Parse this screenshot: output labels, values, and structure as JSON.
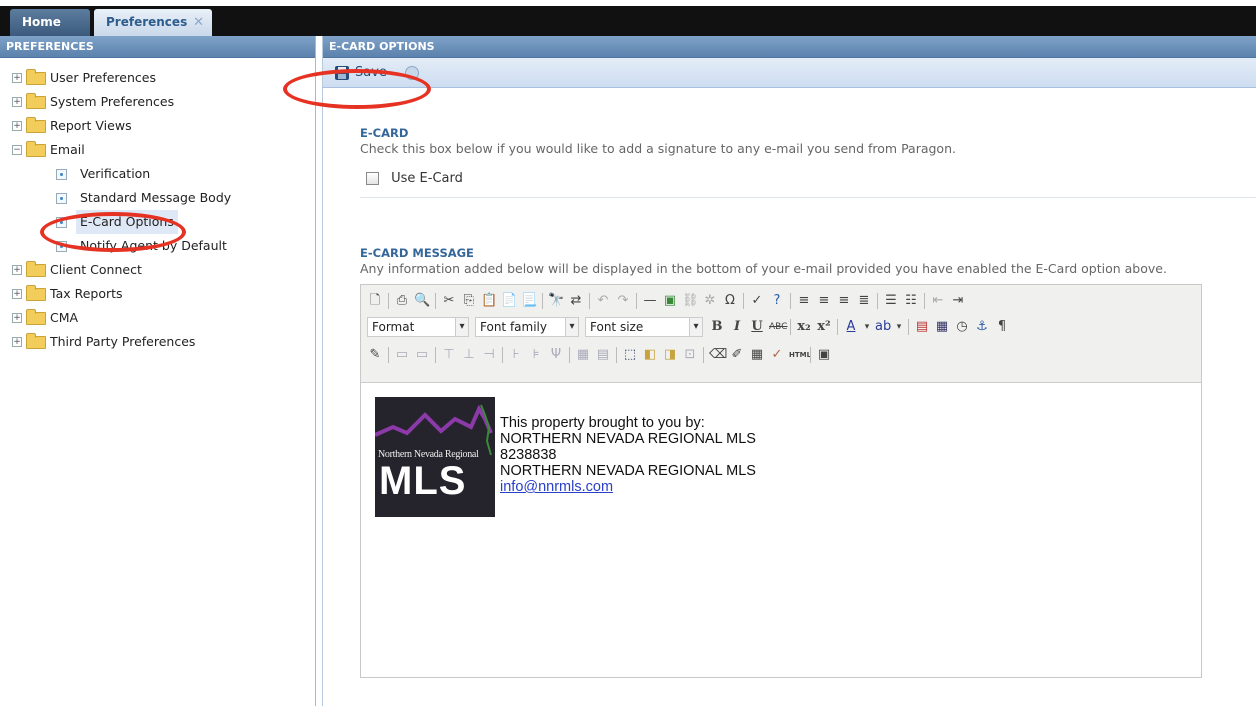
{
  "tabs": [
    {
      "label": "Home"
    },
    {
      "label": "Preferences",
      "close": "✕"
    }
  ],
  "left_panel": {
    "title": "PREFERENCES",
    "tree": [
      {
        "label": "User Preferences",
        "expander": "+"
      },
      {
        "label": "System Preferences",
        "expander": "+"
      },
      {
        "label": "Report Views",
        "expander": "+"
      },
      {
        "label": "Email",
        "expander": "−"
      },
      {
        "label": "Verification"
      },
      {
        "label": "Standard Message Body"
      },
      {
        "label": "E-Card Options",
        "selected": true
      },
      {
        "label": "Notify Agent by Default"
      },
      {
        "label": "Client Connect",
        "expander": "+"
      },
      {
        "label": "Tax Reports",
        "expander": "+"
      },
      {
        "label": "CMA",
        "expander": "+"
      },
      {
        "label": "Third Party Preferences",
        "expander": "+"
      }
    ]
  },
  "right_panel": {
    "title": "E-CARD OPTIONS",
    "toolbar": {
      "save_label": "Save"
    },
    "ecard": {
      "title": "E-CARD",
      "description": "Check this box below if you would like to add a signature to any e-mail you send from Paragon.",
      "checkbox_label": "Use E-Card"
    },
    "message": {
      "title": "E-CARD MESSAGE",
      "description": "Any information added below will be displayed in the bottom of your e-mail provided you have enabled the E-Card option above."
    },
    "editor": {
      "format_label": "Format",
      "font_family_label": "Font family",
      "font_size_label": "Font size",
      "logo_line1": "Northern Nevada Regional",
      "logo_line2": "MLS",
      "signature": [
        "This property brought to you by:",
        "NORTHERN NEVADA REGIONAL MLS",
        "8238838",
        "NORTHERN NEVADA REGIONAL MLS"
      ],
      "email": "info@nnrmls.com"
    }
  },
  "colors": {
    "header_blue": "#5b82ad",
    "title_blue": "#35669a",
    "highlight_red": "#e63223"
  }
}
